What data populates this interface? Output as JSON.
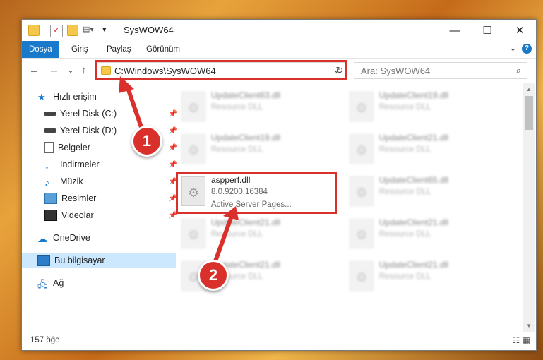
{
  "window": {
    "title": "SysWOW64",
    "controls": {
      "minimize": "—",
      "maximize": "☐",
      "close": "✕"
    }
  },
  "ribbon": {
    "tabs": [
      "Dosya",
      "Giriş",
      "Paylaş",
      "Görünüm"
    ],
    "active_tab": "Dosya",
    "expand_glyph": "⌄",
    "help_glyph": "?"
  },
  "nav": {
    "back": "←",
    "forward": "→",
    "recent": "⌄",
    "up": "↑",
    "address": "C:\\Windows\\SysWOW64",
    "dropdown": "⌄",
    "refresh": "↻",
    "search_placeholder": "Ara: SysWOW64",
    "search_icon": "⌕"
  },
  "sidebar": {
    "items": [
      {
        "label": "Hızlı erişim",
        "icon": "star-icon",
        "pinned": false
      },
      {
        "label": "Yerel Disk (C:)",
        "icon": "drive-icon",
        "pinned": true
      },
      {
        "label": "Yerel Disk (D:)",
        "icon": "drive-icon",
        "pinned": true
      },
      {
        "label": "Belgeler",
        "icon": "document-icon",
        "pinned": true
      },
      {
        "label": "İndirmeler",
        "icon": "download-icon",
        "pinned": true
      },
      {
        "label": "Müzik",
        "icon": "music-icon",
        "pinned": true
      },
      {
        "label": "Resimler",
        "icon": "pictures-icon",
        "pinned": true
      },
      {
        "label": "Videolar",
        "icon": "video-icon",
        "pinned": true
      },
      {
        "label": "OneDrive",
        "icon": "cloud-icon",
        "pinned": false
      },
      {
        "label": "Bu bilgisayar",
        "icon": "computer-icon",
        "pinned": false,
        "selected": true
      },
      {
        "label": "Ağ",
        "icon": "network-icon",
        "pinned": false
      }
    ],
    "pin_glyph": "📌"
  },
  "files": [
    {
      "name": "UpdateClient63.dll",
      "desc": "Resource DLL"
    },
    {
      "name": "UpdateClient19.dll",
      "desc": "Resource DLL"
    },
    {
      "name": "UpdateClient19.dll",
      "desc": "Resource DLL"
    },
    {
      "name": "UpdateClient21.dll",
      "desc": "Resource DLL"
    },
    {
      "name": "aspperf.dll",
      "version": "8.0.9200.16384",
      "desc": "Active Server Pages...",
      "highlighted": true
    },
    {
      "name": "UpdateClient65.dll",
      "desc": "Resource DLL"
    },
    {
      "name": "UpdateClient21.dll",
      "desc": "Resource DLL"
    },
    {
      "name": "UpdateClient21.dll",
      "desc": "Resource DLL"
    },
    {
      "name": "UpdateClient21.dll",
      "desc": "Resource DLL"
    },
    {
      "name": "UpdateClient21.dll",
      "desc": "Resource DLL"
    }
  ],
  "status": {
    "count": "157 öğe",
    "view_icons": "☷ ▦"
  },
  "callouts": {
    "one": "1",
    "two": "2"
  },
  "colors": {
    "accent": "#1979ca",
    "highlight": "#d9302c"
  }
}
